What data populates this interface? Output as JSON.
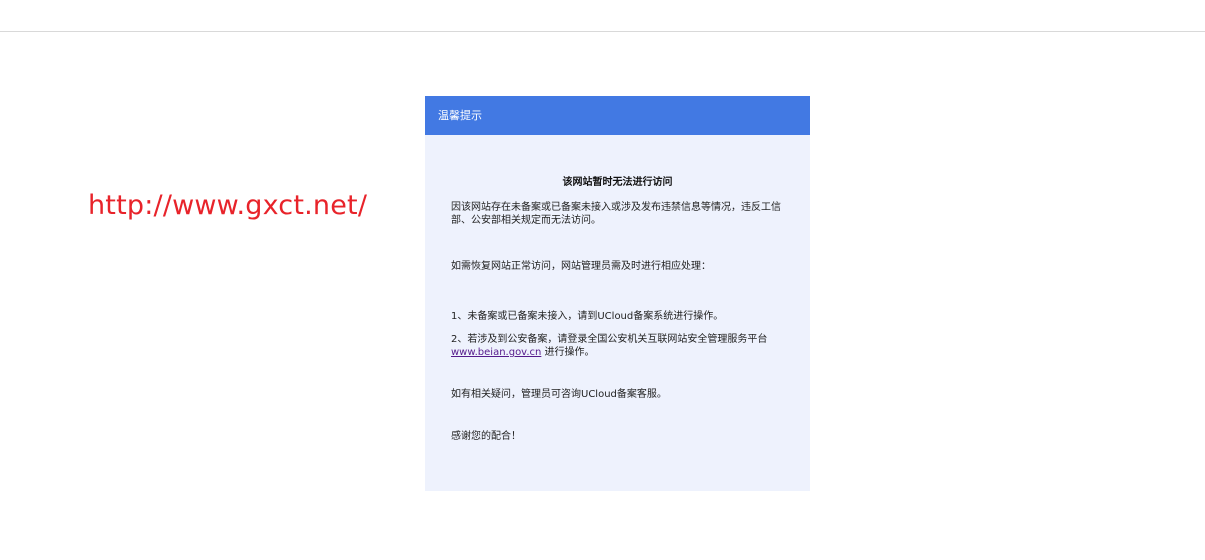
{
  "page": {
    "url_text": "http://www.gxct.net/"
  },
  "notice": {
    "header_title": "温馨提示",
    "title": "该网站暂时无法进行访问",
    "para1": "因该网站存在未备案或已备案未接入或涉及发布违禁信息等情况，违反工信部、公安部相关规定而无法访问。",
    "para2": "如需恢复网站正常访问，网站管理员需及时进行相应处理：",
    "item1": "1、未备案或已备案未接入，请到UCloud备案系统进行操作。",
    "item2_prefix": "2、若涉及到公安备案，请登录全国公安机关互联网站安全管理服务平台",
    "item2_link": "www.beian.gov.cn",
    "item2_suffix": " 进行操作。",
    "para5": "如有相关疑问，管理员可咨询UCloud备案客服。",
    "para6": "感谢您的配合！"
  },
  "colors": {
    "header_bg": "#4279e3",
    "card_bg": "#eef2fd",
    "url_text": "#e8232a",
    "link": "#551a8b"
  }
}
